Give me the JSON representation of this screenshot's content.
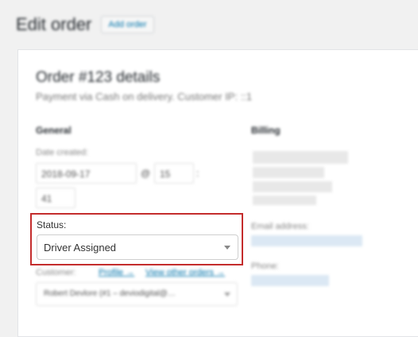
{
  "header": {
    "title": "Edit order",
    "add_button": "Add order"
  },
  "order": {
    "title": "Order #123 details",
    "subtitle": "Payment via Cash on delivery. Customer IP: ::1"
  },
  "general": {
    "heading": "General",
    "date_label": "Date created:",
    "date_value": "2018-09-17",
    "at_label": "@",
    "hour": "15",
    "colon": ":",
    "minute": "41",
    "status_label": "Status:",
    "status_value": "Driver Assigned",
    "customer_label": "Customer:",
    "profile_link": "Profile →",
    "other_orders_link": "View other orders →",
    "customer_value": "Robert Devlore (#1 – deviodigital@…"
  },
  "billing": {
    "heading": "Billing",
    "email_label": "Email address:",
    "phone_label": "Phone:"
  },
  "colors": {
    "highlight": "#c42d2d",
    "link": "#0073aa"
  }
}
